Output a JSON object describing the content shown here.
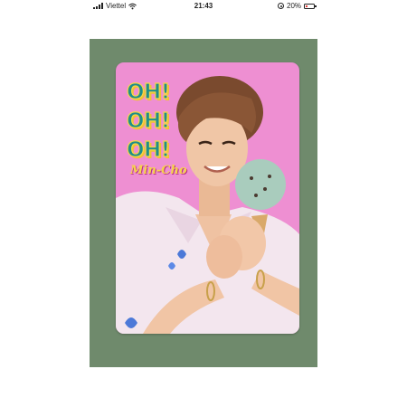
{
  "status_bar": {
    "carrier": "Viettel",
    "time": "21:43",
    "battery": "20%",
    "battery_level": 0.2,
    "icons": [
      "signal-icon",
      "wifi-icon",
      "orientation-lock-icon",
      "battery-icon"
    ]
  },
  "photo": {
    "background_color": "#6f8a6c",
    "card": {
      "background_color": "#ee8fd2",
      "headline_lines": [
        "OH!",
        "OH!",
        "OH!"
      ],
      "brand_logo": "Min-Cho",
      "accent_colors": {
        "text": "#1f8e8a",
        "outline": "#f5d64b"
      }
    }
  }
}
